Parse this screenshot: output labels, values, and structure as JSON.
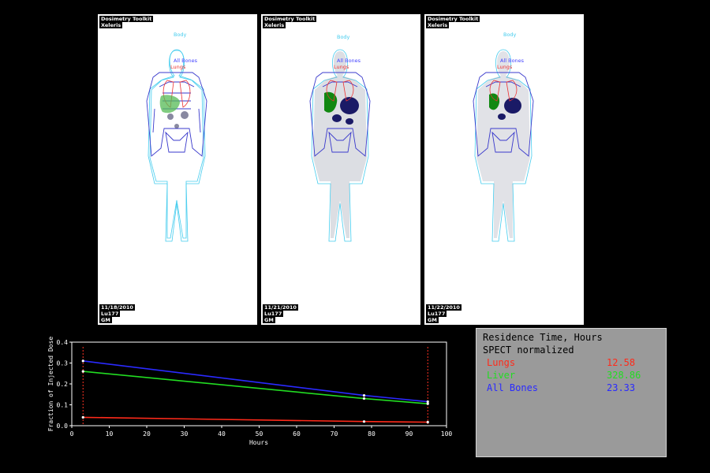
{
  "panels": [
    {
      "app": "Dosimetry Toolkit",
      "vendor": "Xeleris",
      "date": "11/18/2010",
      "isotope": "Lu177",
      "initials": "GM"
    },
    {
      "app": "Dosimetry Toolkit",
      "vendor": "Xeleris",
      "date": "11/21/2010",
      "isotope": "Lu177",
      "initials": "GM"
    },
    {
      "app": "Dosimetry Toolkit",
      "vendor": "Xeleris",
      "date": "11/22/2010",
      "isotope": "Lu177",
      "initials": "GM"
    }
  ],
  "roi_labels": {
    "body": "Body",
    "all_bones": "All Bones",
    "lungs": "Lungs"
  },
  "results": {
    "title": "Residence Time, Hours",
    "subtitle": "SPECT normalized",
    "rows": [
      {
        "name": "Lungs",
        "value": "12.58",
        "color": "#ff2a1a"
      },
      {
        "name": "Liver",
        "value": "328.86",
        "color": "#22dd22"
      },
      {
        "name": "All Bones",
        "value": "23.33",
        "color": "#2a2aff"
      }
    ]
  },
  "colors": {
    "bones_roi": "#3a3acc",
    "body_roi": "#44ccee",
    "lungs_roi": "#ee3333",
    "liver_roi": "#22aa22"
  },
  "chart_data": {
    "type": "line",
    "xlabel": "Hours",
    "ylabel": "Fraction of Injected Dose",
    "xlim": [
      0,
      100
    ],
    "ylim": [
      0,
      0.4
    ],
    "xticks": [
      0,
      10,
      20,
      30,
      40,
      50,
      60,
      70,
      80,
      90,
      100
    ],
    "yticks": [
      0,
      0.1,
      0.2,
      0.3,
      0.4
    ],
    "markers_x": [
      3,
      95
    ],
    "series": [
      {
        "color": "#2a2aff",
        "x": [
          3,
          78,
          95
        ],
        "y": [
          0.31,
          0.145,
          0.115
        ]
      },
      {
        "color": "#22dd22",
        "x": [
          3,
          78,
          95
        ],
        "y": [
          0.26,
          0.13,
          0.105
        ]
      },
      {
        "color": "#ff2a1a",
        "x": [
          3,
          78,
          95
        ],
        "y": [
          0.04,
          0.02,
          0.017
        ]
      }
    ]
  }
}
